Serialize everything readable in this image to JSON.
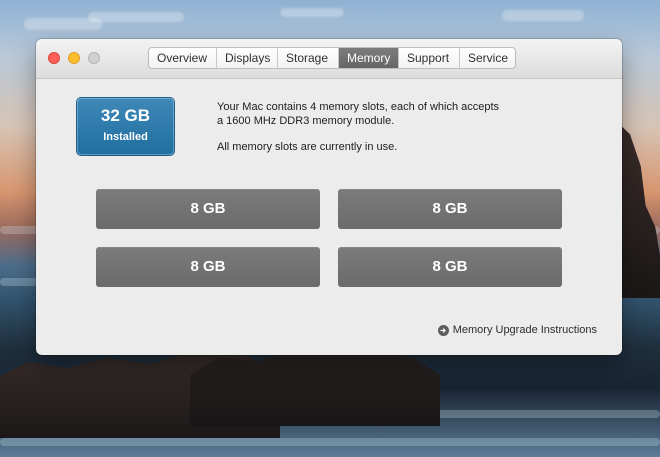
{
  "window": {
    "tabs": [
      {
        "label": "Overview"
      },
      {
        "label": "Displays"
      },
      {
        "label": "Storage"
      },
      {
        "label": "Memory"
      },
      {
        "label": "Support"
      },
      {
        "label": "Service"
      }
    ],
    "active_tab": "Memory"
  },
  "memory": {
    "installed_amount": "32 GB",
    "installed_label": "Installed",
    "summary_line_1": "Your Mac contains 4 memory slots, each of which accepts",
    "summary_line_2": "a 1600 MHz DDR3 memory module.",
    "summary_line_3": "All memory slots are currently in use.",
    "slots": [
      {
        "label": "8 GB"
      },
      {
        "label": "8 GB"
      },
      {
        "label": "8 GB"
      },
      {
        "label": "8 GB"
      }
    ],
    "upgrade_link": "Memory Upgrade Instructions",
    "icons": {
      "close": "close-icon",
      "minimize": "minimize-icon",
      "zoom": "zoom-icon",
      "upgrade": "arrow-right-circle-icon"
    },
    "colors": {
      "active_tab": "#6f6f6f",
      "installed_card": "#2a78aa",
      "slot": "#737373"
    }
  }
}
